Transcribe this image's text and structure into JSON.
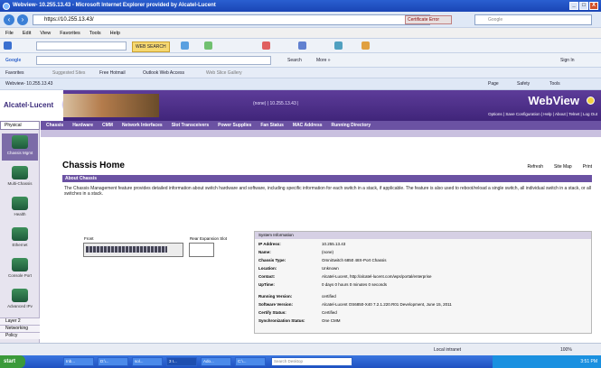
{
  "window": {
    "title": "Webview- 10.255.13.43 - Microsoft Internet Explorer provided by Alcatel-Lucent",
    "controls": [
      "_",
      "□",
      "X"
    ]
  },
  "address_bar": {
    "url": "https://10.255.13.43/",
    "certificate_error": "Certificate Error",
    "search_placeholder": "Google"
  },
  "menubar": [
    "File",
    "Edit",
    "View",
    "Favorites",
    "Tools",
    "Help"
  ],
  "toolbar": {
    "web_search": "WEB SEARCH",
    "google_label": "Google",
    "search_button": "Search",
    "more_button": "More »",
    "sign_in": "Sign In"
  },
  "favorites_bar": {
    "label": "Favorites",
    "items": [
      "Suggested Sites",
      "Free Hotmail",
      "Outlook Web Access",
      "Web Slice Gallery"
    ]
  },
  "tab": {
    "label": "Webview- 10.255.13.43",
    "command_items": [
      "Page",
      "Safety",
      "Tools"
    ]
  },
  "header": {
    "brand": "Alcatel·Lucent",
    "ip_text": "(none) | 10.255.13.43 |",
    "app_name": "WebView",
    "top_links": "Options | Save Configuration | Help | About | Telnet | Log Out"
  },
  "left_nav": {
    "section": "Physical",
    "items": [
      {
        "label": "Chassis Mgmt",
        "selected": true
      },
      {
        "label": "Multi-Chassis",
        "selected": false
      },
      {
        "label": "Health",
        "selected": false
      },
      {
        "label": "Ethernet",
        "selected": false
      },
      {
        "label": "Console Port",
        "selected": false
      },
      {
        "label": "Advanced IPv",
        "selected": false
      }
    ],
    "bottom": [
      "Layer 2",
      "Networking",
      "Policy"
    ]
  },
  "tabs": [
    "Chassis",
    "Hardware",
    "CMM",
    "Network Interfaces",
    "Slot Transceivers",
    "Power Supplies",
    "Fan Status",
    "MAC Address",
    "Running Directory"
  ],
  "page": {
    "title": "Chassis Home",
    "links": [
      "Refresh",
      "Site Map",
      "Print"
    ],
    "section_title": "About Chassis",
    "description": "The Chassis Management feature provides detailed information about switch hardware and software, including specific information for each switch in a stack, if applicable. The feature is also used to reboot/reload a single switch, all individual switch in a stack, or all switches in a stack.",
    "front_label": "Front",
    "rear_label": "Rear Expansion Slot"
  },
  "system_info": {
    "heading": "System Information",
    "rows": [
      {
        "key": "IP Address:",
        "value": "10.255.13.43"
      },
      {
        "key": "Name:",
        "value": "(none)"
      },
      {
        "key": "Chassis Type:",
        "value": "OmniSwitch 6850 48X-Port Chassis"
      },
      {
        "key": "Location:",
        "value": "Unknown"
      },
      {
        "key": "Contact:",
        "value": "Alcatel-Lucent, http://alcatel-lucent.com/wps/portal/enterprise"
      },
      {
        "key": "UpTime:",
        "value": "0 days 0 hours 0 minutes 0 seconds"
      },
      {
        "key": "Running Version:",
        "value": "certified"
      },
      {
        "key": "Software Version:",
        "value": "Alcatel-Lucent OS6850-X40 7.2.1.220.R01 Development, June 15, 2011"
      },
      {
        "key": "Certify Status:",
        "value": "Certified"
      },
      {
        "key": "Synchronization Status:",
        "value": "One CMM"
      }
    ]
  },
  "status_bar": {
    "zone": "Local intranet",
    "zoom": "100%"
  },
  "taskbar": {
    "start": "start",
    "tasks": [
      "Inb...",
      "D:\\...",
      "sol...",
      "3 I...",
      "Ado...",
      "C:\\..."
    ],
    "search_placeholder": "Search Desktop",
    "clock": "3:51 PM"
  }
}
